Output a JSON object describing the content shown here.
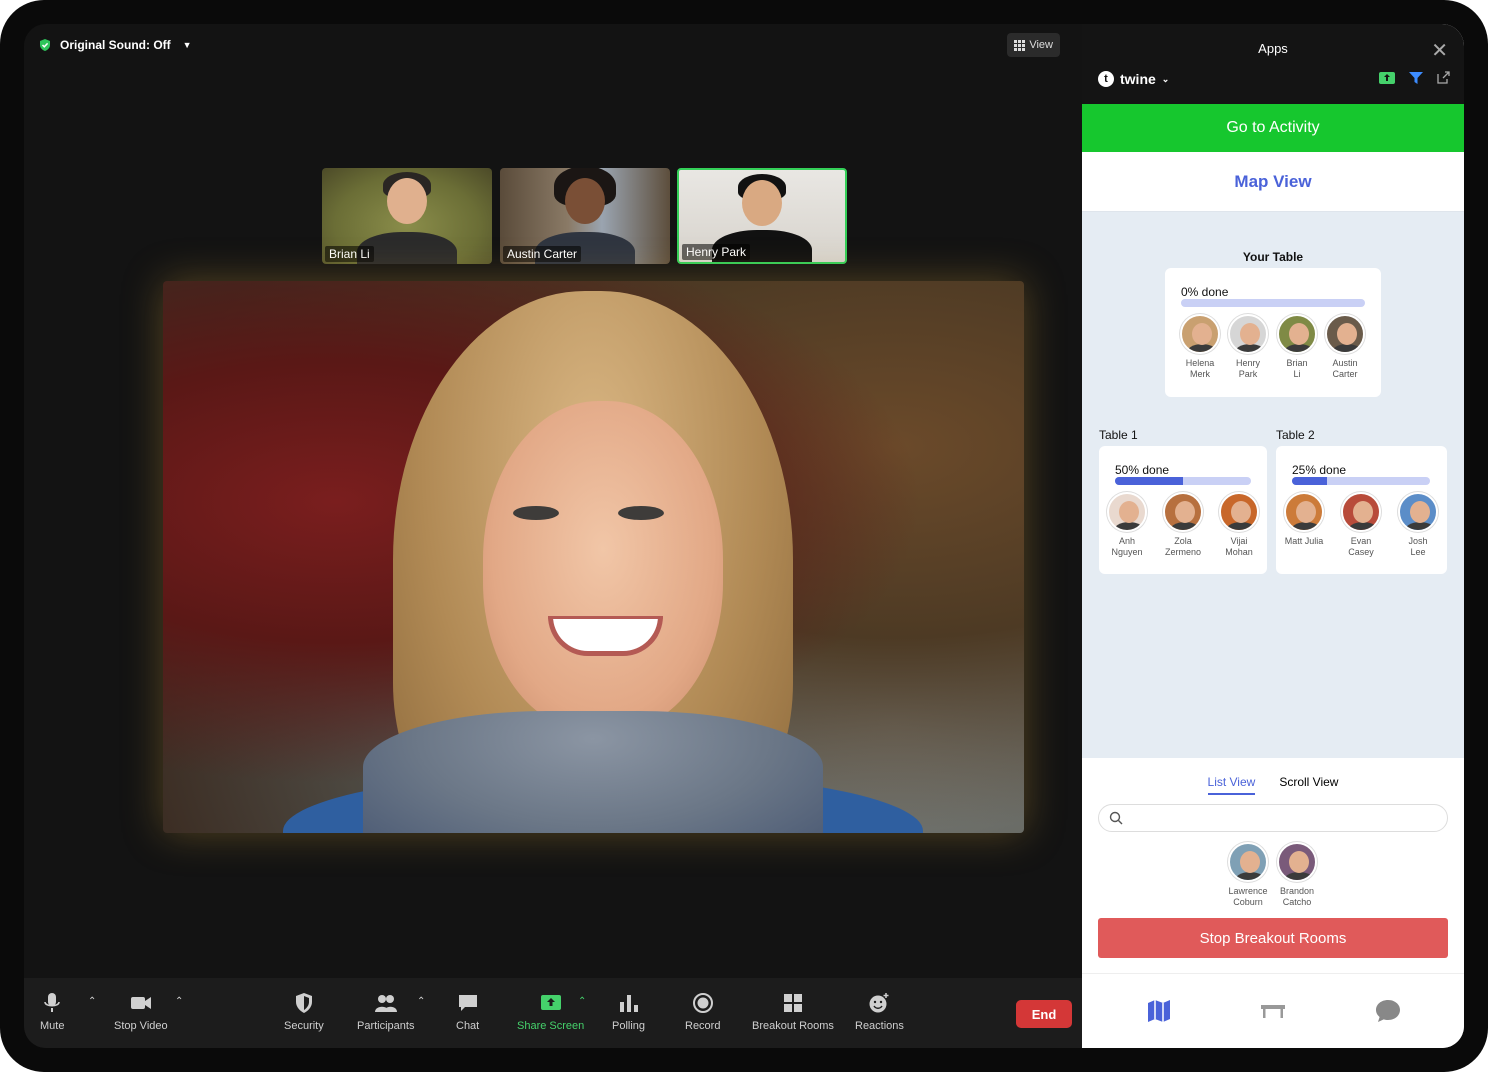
{
  "meeting": {
    "sound_label": "Original Sound: Off",
    "view_label": "View",
    "participants": [
      {
        "name": "Brian Li"
      },
      {
        "name": "Austin Carter"
      },
      {
        "name": "Henry Park"
      }
    ]
  },
  "toolbar": {
    "mute": "Mute",
    "stop_video": "Stop Video",
    "security": "Security",
    "participants": "Participants",
    "chat": "Chat",
    "share_screen": "Share Screen",
    "polling": "Polling",
    "record": "Record",
    "breakout_rooms": "Breakout Rooms",
    "reactions": "Reactions",
    "end": "End"
  },
  "colors": {
    "accent_green": "#16c72e",
    "brand_blue": "#4a62d9",
    "end_red": "#d43737",
    "stop_red": "#e05a5a"
  },
  "panel": {
    "title": "Apps",
    "app_name": "twine",
    "go_to_activity": "Go to Activity",
    "map_view": "Map View",
    "your_table": {
      "title": "Your Table",
      "progress_label": "0% done",
      "progress": 0,
      "members": [
        {
          "first": "Helena",
          "last": "Merk"
        },
        {
          "first": "Henry",
          "last": "Park"
        },
        {
          "first": "Brian",
          "last": "Li"
        },
        {
          "first": "Austin",
          "last": "Carter"
        }
      ]
    },
    "tables": [
      {
        "title": "Table 1",
        "progress_label": "50% done",
        "progress": 0.5,
        "members": [
          {
            "first": "Anh",
            "last": "Nguyen"
          },
          {
            "first": "Zola",
            "last": "Zermeno"
          },
          {
            "first": "Vijai",
            "last": "Mohan"
          }
        ]
      },
      {
        "title": "Table 2",
        "progress_label": "25% done",
        "progress": 0.25,
        "members": [
          {
            "first": "Matt Julia",
            "last": ""
          },
          {
            "first": "Evan",
            "last": "Casey"
          },
          {
            "first": "Josh",
            "last": "Lee"
          }
        ]
      }
    ],
    "list_view": "List View",
    "scroll_view": "Scroll View",
    "unassigned": [
      {
        "first": "Lawrence",
        "last": "Coburn"
      },
      {
        "first": "Brandon",
        "last": "Catcho"
      }
    ],
    "stop_breakout": "Stop Breakout Rooms"
  }
}
